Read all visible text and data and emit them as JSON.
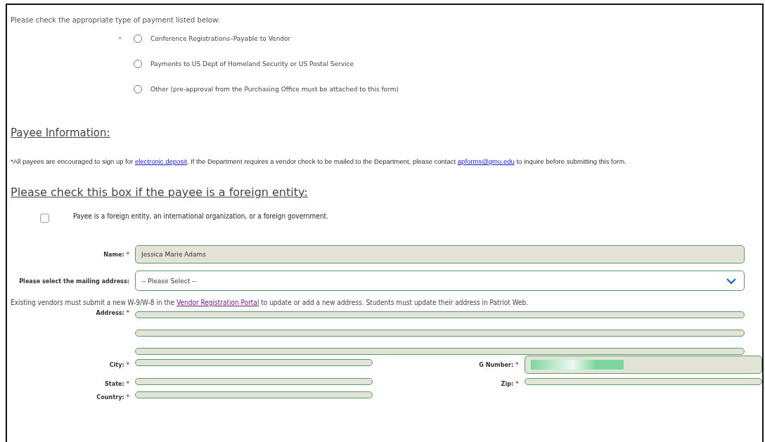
{
  "payment_type": {
    "prompt": "Please check the appropriate type of payment listed below:",
    "marker": "*",
    "options": [
      {
        "label": "Conference Registrations–Payable to Vendor",
        "selected": false
      },
      {
        "label": "Payments to US Dept of Homeland Security or US Postal Service",
        "selected": false
      },
      {
        "label": "Other (pre-approval from the Purchasing Office must be attached to this form)",
        "selected": false
      }
    ]
  },
  "payee_section": {
    "heading": "Payee Information:",
    "note_start": "*All payees are encouraged to sign up for",
    "note_link": "electronic deposit",
    "note_middle": ". If the Department requires a vendor check to be mailed to the Department, please contact",
    "note_email": "apforms@gmu.edu",
    "note_end": "to inquire before submitting this form."
  },
  "foreign_section": {
    "heading": "Please check this box if the payee is a foreign entity:",
    "checkbox": {
      "label": "Payee is a foreign entity, an international organization, or a foreign government.",
      "checked": false
    }
  },
  "name": {
    "label": "Name:",
    "marker": "*",
    "value": "Jessica Marie Adams"
  },
  "mailing_address": {
    "label": "Please select the mailing address:",
    "placeholder": "-- Please Select --"
  },
  "vendor_note": {
    "start": "Existing vendors must submit a new W-9/W-8 in the",
    "link": "Vendor Registration Portal",
    "end": "to update or add a new address. Students must update their address in Patriot Web."
  },
  "address": {
    "label": "Address:",
    "marker": "*"
  },
  "rows": [
    {
      "left": {
        "label": "City:",
        "marker": "*"
      },
      "right": {
        "label": "G Number:",
        "marker": "*",
        "kind": "redacted"
      }
    },
    {
      "left": {
        "label": "State:",
        "marker": "*"
      },
      "right": {
        "label": "Zip:",
        "marker": "*",
        "kind": "text"
      }
    },
    {
      "left": {
        "label": "Country:",
        "marker": "*"
      }
    }
  ]
}
